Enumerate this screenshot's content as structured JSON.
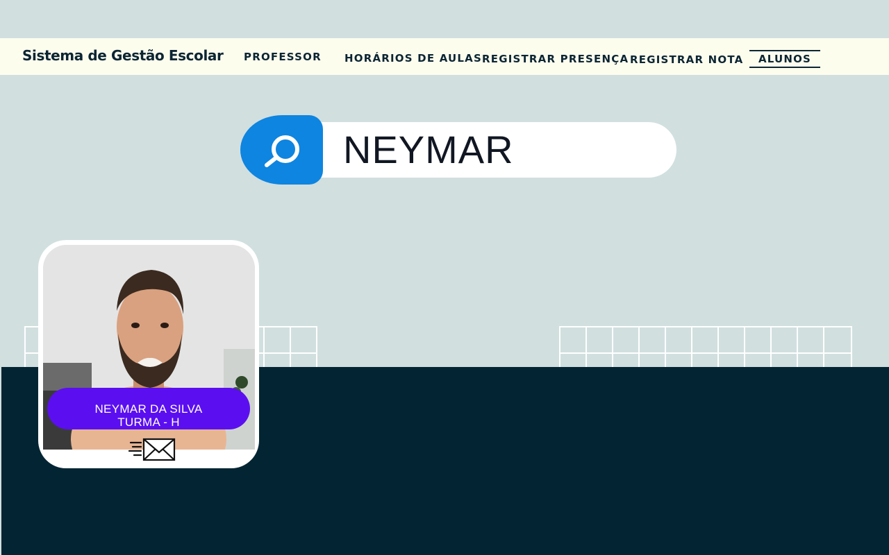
{
  "app": {
    "title": "Sistema de Gestão Escolar"
  },
  "nav": {
    "professor": "PROFESSOR",
    "horarios": "HORÁRIOS DE AULAS",
    "presenca": "REGISTRAR PRESENÇA",
    "nota": "REGISTRAR NOTA",
    "alunos": "ALUNOS",
    "active": "ALUNOS"
  },
  "search": {
    "value": "NEYMAR",
    "icon": "search-icon"
  },
  "student_card": {
    "name": "NEYMAR DA SILVA",
    "class": "TURMA - H",
    "photo": "student-photo",
    "action_icon": "send-mail-icon"
  },
  "colors": {
    "background": "#d1dfdf",
    "navbar": "#fdfdee",
    "nav_text": "#0b2533",
    "search_button": "#0e85e0",
    "dark_band": "#032533",
    "name_pill": "#5b0ff0"
  }
}
